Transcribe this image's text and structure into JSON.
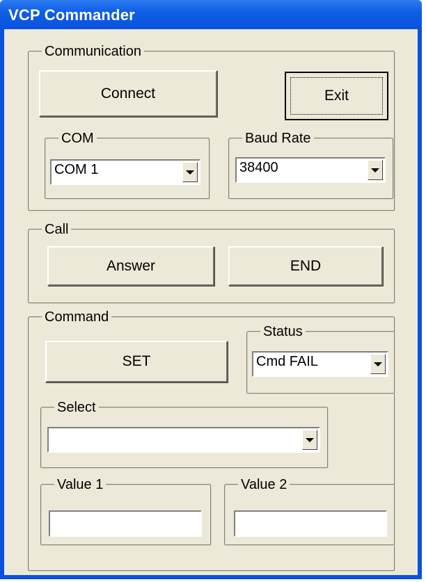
{
  "window": {
    "title": "VCP Commander"
  },
  "communication": {
    "legend": "Communication",
    "connect_label": "Connect",
    "exit_label": "Exit",
    "com": {
      "legend": "COM",
      "value": "COM 1"
    },
    "baud": {
      "legend": "Baud Rate",
      "value": "38400"
    }
  },
  "call": {
    "legend": "Call",
    "answer_label": "Answer",
    "end_label": "END"
  },
  "command": {
    "legend": "Command",
    "set_label": "SET",
    "status": {
      "legend": "Status",
      "value": "Cmd FAIL"
    },
    "select": {
      "legend": "Select",
      "value": ""
    },
    "value1": {
      "legend": "Value 1",
      "value": ""
    },
    "value2": {
      "legend": "Value 2",
      "value": ""
    }
  },
  "icons": {
    "dropdown_arrow": "triangle-down"
  }
}
